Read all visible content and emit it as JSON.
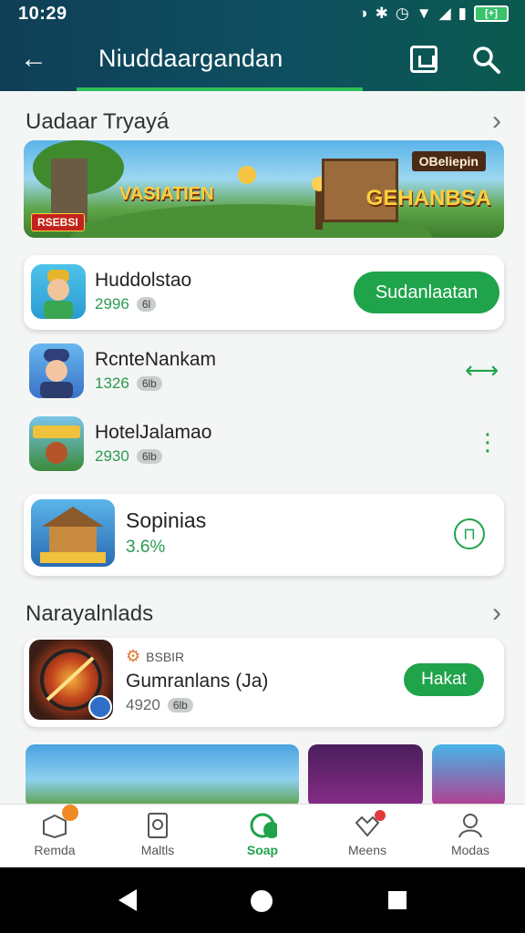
{
  "status_bar": {
    "time": "10:29",
    "battery": "[+]"
  },
  "app_bar": {
    "title": "Niuddaargandan"
  },
  "section1": {
    "title": "Uadaar Tryayá",
    "banner": {
      "left_text": "VASIATIEN",
      "right_text": "GEHANBSA",
      "tag": "RSEBSI",
      "sign": "OBeliepin"
    }
  },
  "apps": [
    {
      "name": "Huddolstao",
      "meta": "2996",
      "pill": "6l",
      "button": "Sudanlaatan"
    },
    {
      "name": "RcnteNankam",
      "meta": "1326",
      "pill": "6lb"
    },
    {
      "name": "HotelJalamao",
      "meta": "2930",
      "pill": "6lb"
    },
    {
      "name": "Sopinias",
      "meta": "3.6%"
    }
  ],
  "section2": {
    "title": "Narayalnlads",
    "featured": {
      "badge": "BSBIR",
      "name": "Gumranlans (Ja)",
      "meta": "4920",
      "pill": "6lb",
      "button": "Hakat"
    }
  },
  "bottom_nav": [
    {
      "label": "Remda",
      "badge": ""
    },
    {
      "label": "Maltls",
      "badge": ""
    },
    {
      "label": "Soap",
      "badge": ""
    },
    {
      "label": "Meens",
      "badge": ""
    },
    {
      "label": "Modas",
      "badge": ""
    }
  ],
  "colors": {
    "accent": "#1fa34b",
    "topbar": "#0e4f60"
  }
}
